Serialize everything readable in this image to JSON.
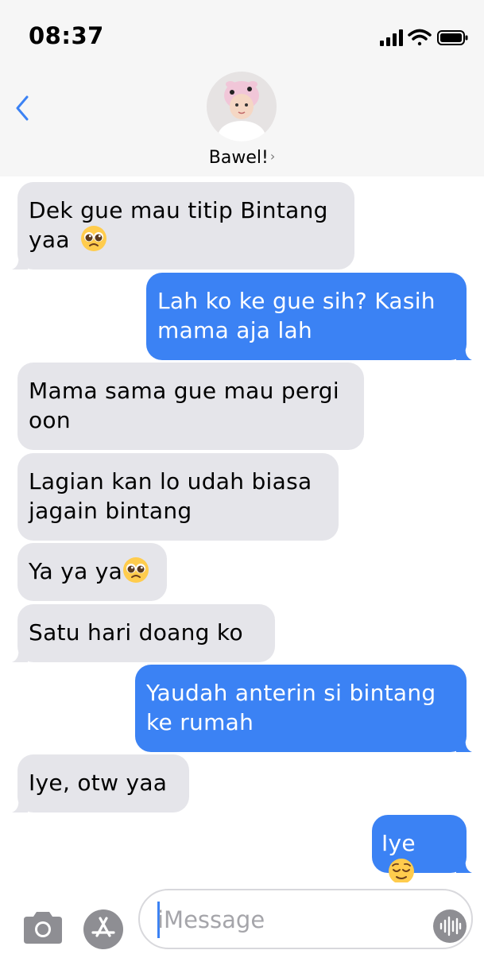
{
  "status_bar": {
    "time": "08:37"
  },
  "header": {
    "contact_name": "Bawel!",
    "name_chevron": "›"
  },
  "messages": [
    {
      "dir": "in",
      "lines": [
        "Dek gue mau titip Bintang",
        "yaa"
      ],
      "emoji": "pleading-face"
    },
    {
      "dir": "out",
      "lines": [
        "Lah ko ke gue sih? Kasih",
        "mama aja lah"
      ]
    },
    {
      "dir": "in",
      "lines": [
        "Mama sama gue mau pergi",
        "oon"
      ]
    },
    {
      "dir": "in",
      "lines": [
        "Lagian kan lo udah biasa",
        "jagain bintang"
      ]
    },
    {
      "dir": "in",
      "lines": [
        "Ya ya ya"
      ],
      "emoji": "pleading-face"
    },
    {
      "dir": "in",
      "lines": [
        "Satu hari doang ko"
      ]
    },
    {
      "dir": "out",
      "lines": [
        "Yaudah anterin si bintang",
        "ke rumah"
      ]
    },
    {
      "dir": "in",
      "lines": [
        "Iye, otw yaa"
      ]
    },
    {
      "dir": "out",
      "lines": [
        "Iye"
      ],
      "emoji": "relieved-face"
    }
  ],
  "composer": {
    "placeholder": "iMessage"
  },
  "colors": {
    "incoming_bubble": "#e5e5ea",
    "outgoing_bubble": "#3b82f4",
    "accent": "#3b82f4"
  }
}
